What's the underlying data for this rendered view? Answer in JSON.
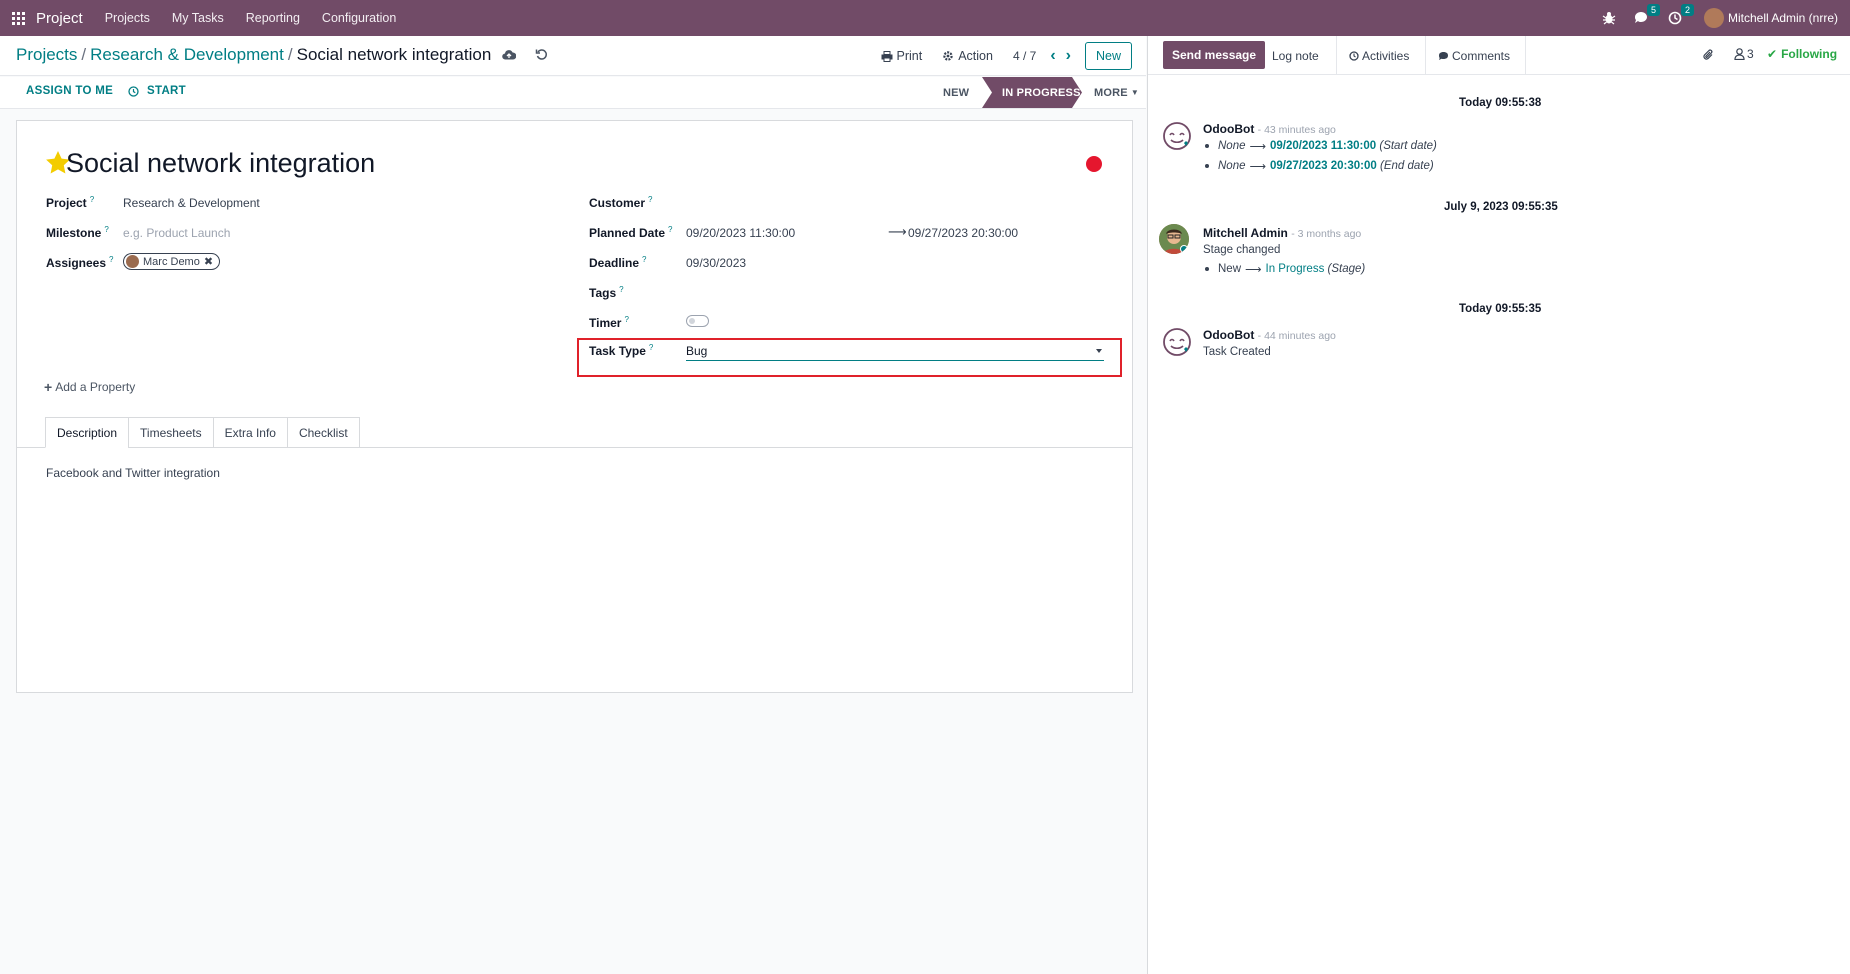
{
  "navbar": {
    "app_name": "Project",
    "menu": [
      "Projects",
      "My Tasks",
      "Reporting",
      "Configuration"
    ],
    "messages_count": "5",
    "activities_count": "2",
    "user_name": "Mitchell Admin (nrre)"
  },
  "breadcrumb": {
    "items": [
      "Projects",
      "Research & Development"
    ],
    "current": "Social network integration"
  },
  "control": {
    "print": "Print",
    "action": "Action",
    "pager": "4 / 7",
    "new": "New"
  },
  "statusbar": {
    "assign": "ASSIGN TO ME",
    "start": "START",
    "stages": [
      "NEW",
      "IN PROGRESS"
    ],
    "active_stage": "IN PROGRESS",
    "more": "MORE"
  },
  "form": {
    "title": "Social network integration",
    "fields": {
      "project_label": "Project",
      "project_value": "Research & Development",
      "milestone_label": "Milestone",
      "milestone_placeholder": "e.g. Product Launch",
      "assignees_label": "Assignees",
      "assignee": "Marc Demo",
      "customer_label": "Customer",
      "planned_label": "Planned Date",
      "planned_start": "09/20/2023 11:30:00",
      "planned_end": "09/27/2023 20:30:00",
      "deadline_label": "Deadline",
      "deadline_value": "09/30/2023",
      "tags_label": "Tags",
      "timer_label": "Timer",
      "task_type_label": "Task Type",
      "task_type_value": "Bug"
    },
    "add_property": "Add a Property",
    "tabs": [
      "Description",
      "Timesheets",
      "Extra Info",
      "Checklist"
    ],
    "description": "Facebook and Twitter integration",
    "priority_color": "#e5162e"
  },
  "chatter": {
    "send_message": "Send message",
    "log_note": "Log note",
    "activities": "Activities",
    "comments": "Comments",
    "followers_count": "3",
    "following": "Following",
    "groups": [
      {
        "date": "Today 09:55:38",
        "author": "OdooBot",
        "ago": "- 43 minutes ago",
        "lines": [
          {
            "old": "None",
            "new": "09/20/2023 11:30:00",
            "field": "(Start date)"
          },
          {
            "old": "None",
            "new": "09/27/2023 20:30:00",
            "field": "(End date)"
          }
        ]
      },
      {
        "date": "July 9, 2023 09:55:35",
        "author": "Mitchell Admin",
        "ago": "- 3 months ago",
        "body": "Stage changed",
        "lines": [
          {
            "old": "New",
            "new": "In Progress",
            "field": "(Stage)"
          }
        ]
      },
      {
        "date": "Today 09:55:35",
        "author": "OdooBot",
        "ago": "- 44 minutes ago",
        "body": "Task Created"
      }
    ]
  },
  "colors": {
    "brand": "#714b67",
    "accent": "#017e84",
    "highlight": "#e0212a"
  }
}
